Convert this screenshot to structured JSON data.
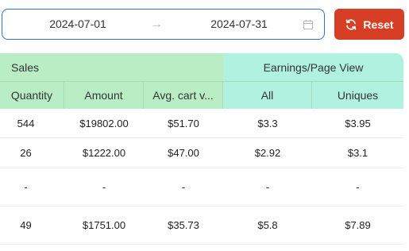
{
  "date_range": {
    "start": "2024-07-01",
    "arrow": "→",
    "end": "2024-07-31"
  },
  "reset_button": {
    "label": "Reset"
  },
  "table": {
    "groups": {
      "sales": "Sales",
      "earnings": "Earnings/Page View"
    },
    "columns": [
      "Quantity",
      "Amount",
      "Avg. cart v...",
      "All",
      "Uniques"
    ],
    "rows": [
      [
        "544",
        "$19802.00",
        "$51.70",
        "$3.3",
        "$3.95"
      ],
      [
        "26",
        "$1222.00",
        "$47.00",
        "$2.92",
        "$3.1"
      ],
      [
        "-",
        "-",
        "-",
        "-",
        "-"
      ],
      [
        "49",
        "$1751.00",
        "$35.73",
        "$5.8",
        "$7.89"
      ]
    ]
  },
  "colors": {
    "sales_header_bg": "#b9eec5",
    "earnings_header_bg": "#b1f1e0",
    "reset_bg": "#d63f25",
    "date_border": "#2f6fd6"
  }
}
